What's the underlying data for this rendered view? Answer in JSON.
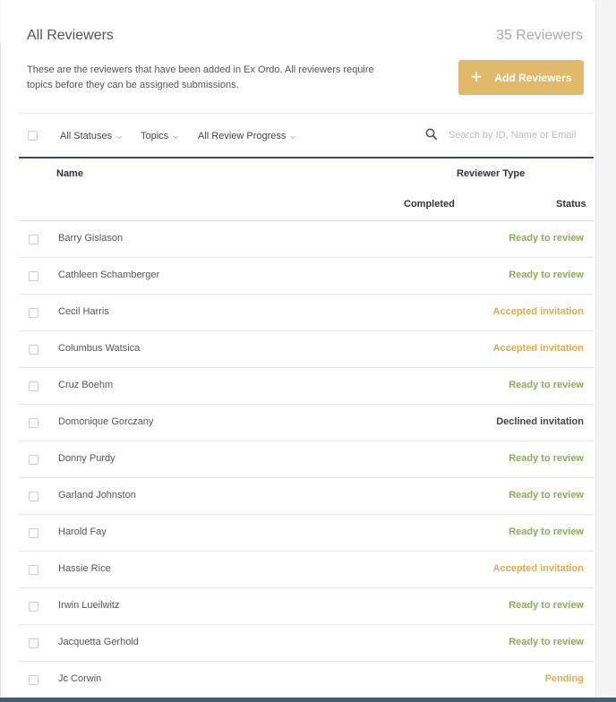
{
  "header": {
    "title": "All Reviewers",
    "count": "35 Reviewers",
    "description": "These are the reviewers that have been added in Ex Ordo. All reviewers require topics before they can be assigned submissions.",
    "add_button_label": "Add Reviewers",
    "add_button_icon": "plus-icon",
    "accent_color": "#e0b96b"
  },
  "filters": {
    "statuses": "All Statuses",
    "topics": "Topics",
    "review_progress": "All Review Progress",
    "search_placeholder": "Search by ID, Name or Email",
    "search_value": ""
  },
  "columns": {
    "name": "Name",
    "reviewer_type": "Reviewer Type",
    "completed": "Completed",
    "status": "Status"
  },
  "status_colors": {
    "Ready to review": "#8aad55",
    "Accepted invitation": "#e3a94a",
    "Declined invitation": "#444444",
    "Pending": "#e3a94a"
  },
  "rows": [
    {
      "name": "Barry Gislason",
      "status": "Ready to review"
    },
    {
      "name": "Cathleen Schamberger",
      "status": "Ready to review"
    },
    {
      "name": "Cecil Harris",
      "status": "Accepted invitation"
    },
    {
      "name": "Columbus Watsica",
      "status": "Accepted invitation"
    },
    {
      "name": "Cruz Boehm",
      "status": "Ready to review"
    },
    {
      "name": "Domonique Gorczany",
      "status": "Declined invitation"
    },
    {
      "name": "Donny Purdy",
      "status": "Ready to review"
    },
    {
      "name": "Garland Johnston",
      "status": "Ready to review"
    },
    {
      "name": "Harold Fay",
      "status": "Ready to review"
    },
    {
      "name": "Hassie Rice",
      "status": "Accepted invitation"
    },
    {
      "name": "Irwin Lueilwitz",
      "status": "Ready to review"
    },
    {
      "name": "Jacquetta Gerhold",
      "status": "Ready to review"
    },
    {
      "name": "Jc Corwin",
      "status": "Pending"
    }
  ]
}
